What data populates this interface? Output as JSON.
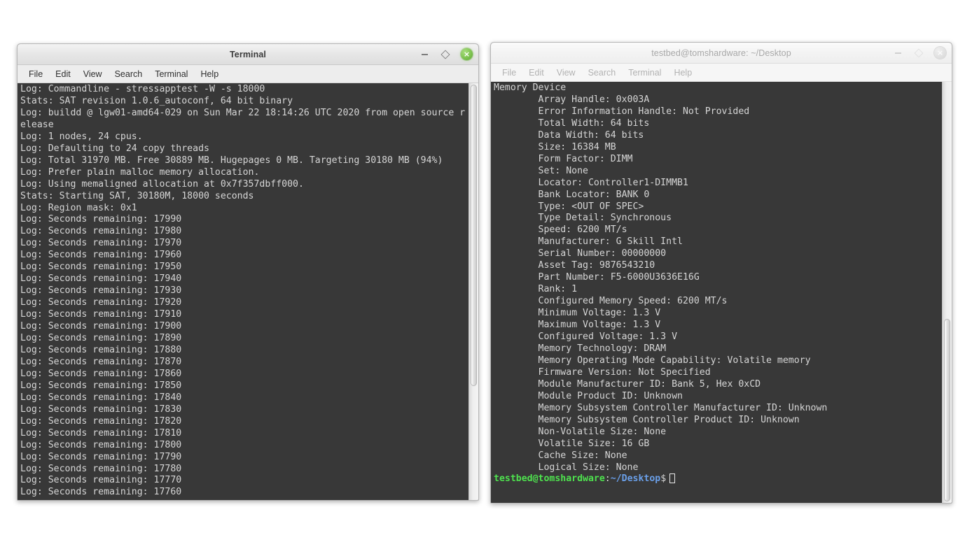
{
  "desktop": {
    "background": "#ffffff"
  },
  "windows": {
    "left": {
      "title": "Terminal",
      "state": "active",
      "menu": [
        "File",
        "Edit",
        "View",
        "Search",
        "Terminal",
        "Help"
      ],
      "buttons": {
        "minimize": "–",
        "maximize": "□",
        "close": "×"
      },
      "close_color": "#7ec350",
      "terminal": {
        "background": "#383838",
        "foreground": "#d6d6d6",
        "scrollbar": {
          "thumb_top_pct": 0,
          "thumb_height_pct": 73
        },
        "lines": [
          "Log: Commandline - stressapptest -W -s 18000",
          "Stats: SAT revision 1.0.6_autoconf, 64 bit binary",
          "Log: buildd @ lgw01-amd64-029 on Sun Mar 22 18:14:26 UTC 2020 from open source r",
          "elease",
          "Log: 1 nodes, 24 cpus.",
          "Log: Defaulting to 24 copy threads",
          "Log: Total 31970 MB. Free 30889 MB. Hugepages 0 MB. Targeting 30180 MB (94%)",
          "Log: Prefer plain malloc memory allocation.",
          "Log: Using memaligned allocation at 0x7f357dbff000.",
          "Stats: Starting SAT, 30180M, 18000 seconds",
          "Log: Region mask: 0x1",
          "Log: Seconds remaining: 17990",
          "Log: Seconds remaining: 17980",
          "Log: Seconds remaining: 17970",
          "Log: Seconds remaining: 17960",
          "Log: Seconds remaining: 17950",
          "Log: Seconds remaining: 17940",
          "Log: Seconds remaining: 17930",
          "Log: Seconds remaining: 17920",
          "Log: Seconds remaining: 17910",
          "Log: Seconds remaining: 17900",
          "Log: Seconds remaining: 17890",
          "Log: Seconds remaining: 17880",
          "Log: Seconds remaining: 17870",
          "Log: Seconds remaining: 17860",
          "Log: Seconds remaining: 17850",
          "Log: Seconds remaining: 17840",
          "Log: Seconds remaining: 17830",
          "Log: Seconds remaining: 17820",
          "Log: Seconds remaining: 17810",
          "Log: Seconds remaining: 17800",
          "Log: Seconds remaining: 17790",
          "Log: Seconds remaining: 17780",
          "Log: Seconds remaining: 17770",
          "Log: Seconds remaining: 17760"
        ]
      }
    },
    "right": {
      "title": "testbed@tomshardware: ~/Desktop",
      "state": "inactive",
      "menu": [
        "File",
        "Edit",
        "View",
        "Search",
        "Terminal",
        "Help"
      ],
      "buttons": {
        "minimize": "–",
        "maximize": "□",
        "close": "×"
      },
      "close_color": "#d4d4d4",
      "terminal": {
        "background": "#383838",
        "foreground": "#d6d6d6",
        "scrollbar": {
          "thumb_top_pct": 56,
          "thumb_height_pct": 44
        },
        "lines": [
          "Memory Device",
          "        Array Handle: 0x003A",
          "        Error Information Handle: Not Provided",
          "        Total Width: 64 bits",
          "        Data Width: 64 bits",
          "        Size: 16384 MB",
          "        Form Factor: DIMM",
          "        Set: None",
          "        Locator: Controller1-DIMMB1",
          "        Bank Locator: BANK 0",
          "        Type: <OUT OF SPEC>",
          "        Type Detail: Synchronous",
          "        Speed: 6200 MT/s",
          "        Manufacturer: G Skill Intl",
          "        Serial Number: 00000000",
          "        Asset Tag: 9876543210",
          "        Part Number: F5-6000U3636E16G",
          "        Rank: 1",
          "        Configured Memory Speed: 6200 MT/s",
          "        Minimum Voltage: 1.3 V",
          "        Maximum Voltage: 1.3 V",
          "        Configured Voltage: 1.3 V",
          "        Memory Technology: DRAM",
          "        Memory Operating Mode Capability: Volatile memory",
          "        Firmware Version: Not Specified",
          "        Module Manufacturer ID: Bank 5, Hex 0xCD",
          "        Module Product ID: Unknown",
          "        Memory Subsystem Controller Manufacturer ID: Unknown",
          "        Memory Subsystem Controller Product ID: Unknown",
          "        Non-Volatile Size: None",
          "        Volatile Size: 16 GB",
          "        Cache Size: None",
          "        Logical Size: None",
          ""
        ],
        "prompt": {
          "user_host": "testbed@tomshardware",
          "colon": ":",
          "path": "~/Desktop",
          "dollar": "$",
          "user_color": "#4ee24e",
          "path_color": "#6a9fe8"
        }
      }
    }
  }
}
